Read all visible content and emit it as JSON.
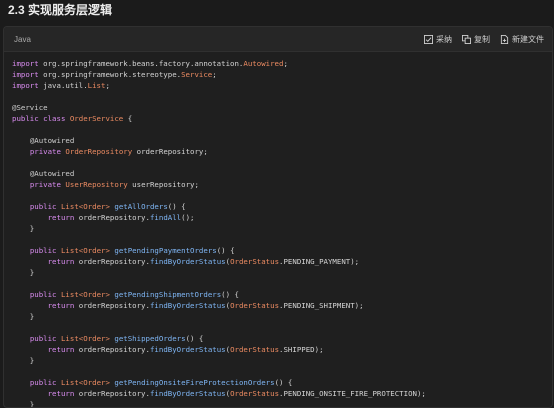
{
  "heading": "2.3 实现服务层逻辑",
  "code_block": {
    "language": "Java",
    "actions": {
      "collect_label": "采纳",
      "copy_label": "复制",
      "new_file_label": "新建文件"
    }
  },
  "code_lines": [
    [
      [
        "k",
        "import"
      ],
      [
        "p",
        " org.springframework.beans.factory.annotation."
      ],
      [
        "c",
        "Autowired"
      ],
      [
        "p",
        ";"
      ]
    ],
    [
      [
        "k",
        "import"
      ],
      [
        "p",
        " org.springframework.stereotype."
      ],
      [
        "c",
        "Service"
      ],
      [
        "p",
        ";"
      ]
    ],
    [
      [
        "k",
        "import"
      ],
      [
        "p",
        " java.util."
      ],
      [
        "c",
        "List"
      ],
      [
        "p",
        ";"
      ]
    ],
    [],
    [
      [
        "a",
        "@Service"
      ]
    ],
    [
      [
        "k",
        "public"
      ],
      [
        "p",
        " "
      ],
      [
        "k",
        "class"
      ],
      [
        "p",
        " "
      ],
      [
        "c",
        "OrderService"
      ],
      [
        "p",
        " {"
      ]
    ],
    [],
    [
      [
        "p",
        "    "
      ],
      [
        "a",
        "@Autowired"
      ]
    ],
    [
      [
        "p",
        "    "
      ],
      [
        "k",
        "private"
      ],
      [
        "p",
        " "
      ],
      [
        "c",
        "OrderRepository"
      ],
      [
        "p",
        " orderRepository;"
      ]
    ],
    [],
    [
      [
        "p",
        "    "
      ],
      [
        "a",
        "@Autowired"
      ]
    ],
    [
      [
        "p",
        "    "
      ],
      [
        "k",
        "private"
      ],
      [
        "p",
        " "
      ],
      [
        "c",
        "UserRepository"
      ],
      [
        "p",
        " userRepository;"
      ]
    ],
    [],
    [
      [
        "p",
        "    "
      ],
      [
        "k",
        "public"
      ],
      [
        "p",
        " "
      ],
      [
        "c",
        "List<Order>"
      ],
      [
        "p",
        " "
      ],
      [
        "f",
        "getAllOrders"
      ],
      [
        "p",
        "() {"
      ]
    ],
    [
      [
        "p",
        "        "
      ],
      [
        "k",
        "return"
      ],
      [
        "p",
        " orderRepository."
      ],
      [
        "f",
        "findAll"
      ],
      [
        "p",
        "();"
      ]
    ],
    [
      [
        "p",
        "    }"
      ]
    ],
    [],
    [
      [
        "p",
        "    "
      ],
      [
        "k",
        "public"
      ],
      [
        "p",
        " "
      ],
      [
        "c",
        "List<Order>"
      ],
      [
        "p",
        " "
      ],
      [
        "f",
        "getPendingPaymentOrders"
      ],
      [
        "p",
        "() {"
      ]
    ],
    [
      [
        "p",
        "        "
      ],
      [
        "k",
        "return"
      ],
      [
        "p",
        " orderRepository."
      ],
      [
        "f",
        "findByOrderStatus"
      ],
      [
        "p",
        "("
      ],
      [
        "c",
        "OrderStatus"
      ],
      [
        "p",
        ".PENDING_PAYMENT);"
      ]
    ],
    [
      [
        "p",
        "    }"
      ]
    ],
    [],
    [
      [
        "p",
        "    "
      ],
      [
        "k",
        "public"
      ],
      [
        "p",
        " "
      ],
      [
        "c",
        "List<Order>"
      ],
      [
        "p",
        " "
      ],
      [
        "f",
        "getPendingShipmentOrders"
      ],
      [
        "p",
        "() {"
      ]
    ],
    [
      [
        "p",
        "        "
      ],
      [
        "k",
        "return"
      ],
      [
        "p",
        " orderRepository."
      ],
      [
        "f",
        "findByOrderStatus"
      ],
      [
        "p",
        "("
      ],
      [
        "c",
        "OrderStatus"
      ],
      [
        "p",
        ".PENDING_SHIPMENT);"
      ]
    ],
    [
      [
        "p",
        "    }"
      ]
    ],
    [],
    [
      [
        "p",
        "    "
      ],
      [
        "k",
        "public"
      ],
      [
        "p",
        " "
      ],
      [
        "c",
        "List<Order>"
      ],
      [
        "p",
        " "
      ],
      [
        "f",
        "getShippedOrders"
      ],
      [
        "p",
        "() {"
      ]
    ],
    [
      [
        "p",
        "        "
      ],
      [
        "k",
        "return"
      ],
      [
        "p",
        " orderRepository."
      ],
      [
        "f",
        "findByOrderStatus"
      ],
      [
        "p",
        "("
      ],
      [
        "c",
        "OrderStatus"
      ],
      [
        "p",
        ".SHIPPED);"
      ]
    ],
    [
      [
        "p",
        "    }"
      ]
    ],
    [],
    [
      [
        "p",
        "    "
      ],
      [
        "k",
        "public"
      ],
      [
        "p",
        " "
      ],
      [
        "c",
        "List<Order>"
      ],
      [
        "p",
        " "
      ],
      [
        "f",
        "getPendingOnsiteFireProtectionOrders"
      ],
      [
        "p",
        "() {"
      ]
    ],
    [
      [
        "p",
        "        "
      ],
      [
        "k",
        "return"
      ],
      [
        "p",
        " orderRepository."
      ],
      [
        "f",
        "findByOrderStatus"
      ],
      [
        "p",
        "("
      ],
      [
        "c",
        "OrderStatus"
      ],
      [
        "p",
        ".PENDING_ONSITE_FIRE_PROTECTION);"
      ]
    ],
    [
      [
        "p",
        "    }"
      ]
    ]
  ]
}
